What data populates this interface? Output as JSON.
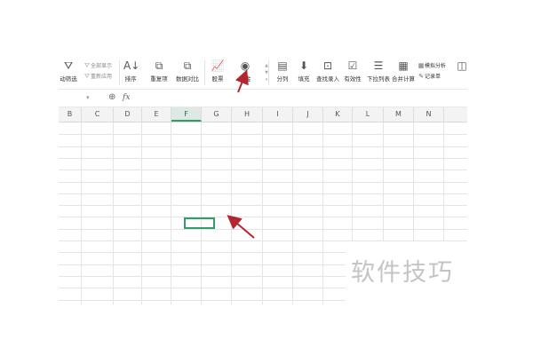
{
  "toolbar": {
    "filter_left_label": "动筛选",
    "show_all_label": "全部显示",
    "reapply_label": "重新应用",
    "sort_label": "排序",
    "duplicates_label": "重复项",
    "compare_label": "数据对比",
    "stock_label": "股票",
    "fund_label": "基金",
    "split_label": "分列",
    "fill_label": "填充",
    "lookup_label": "查找录入",
    "validity_label": "有效性",
    "dropdown_label": "下拉列表",
    "consolidate_label": "合并计算",
    "simulation_label": "模拟分析",
    "record_label": "记录单"
  },
  "formula_bar": {
    "fx_label": "fx"
  },
  "sheet": {
    "columns": [
      "B",
      "C",
      "D",
      "E",
      "F",
      "G",
      "H",
      "I",
      "J",
      "K",
      "L",
      "M",
      "N"
    ],
    "selected_column": "F"
  },
  "watermark": {
    "text": "软件技巧"
  },
  "colors": {
    "accent": "#2f9e68",
    "annotation_arrow": "#b3262f"
  }
}
